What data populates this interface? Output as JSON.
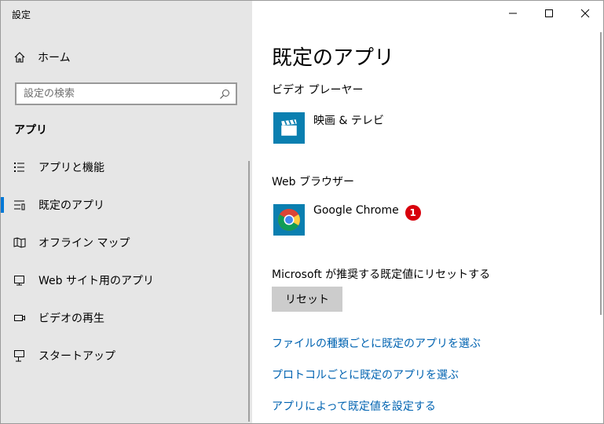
{
  "window": {
    "title": "設定",
    "controls": {
      "minimize": "minimize-icon",
      "maximize": "maximize-icon",
      "close": "close-icon"
    }
  },
  "sidebar": {
    "home_label": "ホーム",
    "search_placeholder": "設定の検索",
    "section_title": "アプリ",
    "items": [
      {
        "label": "アプリと機能",
        "icon": "apps-features-icon"
      },
      {
        "label": "既定のアプリ",
        "icon": "default-apps-icon",
        "active": true
      },
      {
        "label": "オフライン マップ",
        "icon": "offline-maps-icon"
      },
      {
        "label": "Web サイト用のアプリ",
        "icon": "apps-for-websites-icon"
      },
      {
        "label": "ビデオの再生",
        "icon": "video-playback-icon"
      },
      {
        "label": "スタートアップ",
        "icon": "startup-icon"
      }
    ]
  },
  "main": {
    "page_title": "既定のアプリ",
    "video_player": {
      "label": "ビデオ プレーヤー",
      "app_name": "映画 & テレビ",
      "icon": "movies-tv-icon"
    },
    "web_browser": {
      "label": "Web ブラウザー",
      "app_name": "Google Chrome",
      "icon": "chrome-icon",
      "badge": "1"
    },
    "reset": {
      "label": "Microsoft が推奨する既定値にリセットする",
      "button": "リセット"
    },
    "links": [
      "ファイルの種類ごとに既定のアプリを選ぶ",
      "プロトコルごとに既定のアプリを選ぶ",
      "アプリによって既定値を設定する"
    ]
  },
  "colors": {
    "accent": "#0078d7",
    "link": "#0063b1",
    "sidebar_bg": "#e6e6e6",
    "badge": "#d8000c"
  }
}
